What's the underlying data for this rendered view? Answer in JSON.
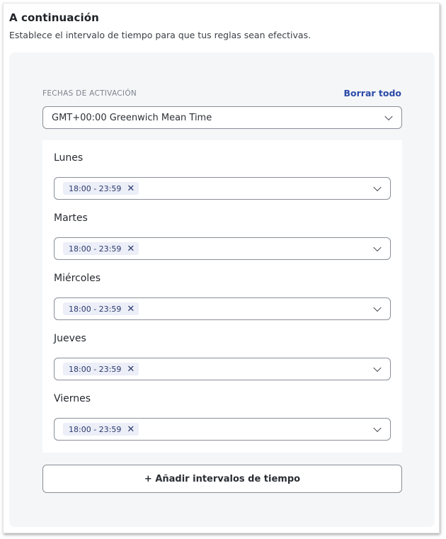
{
  "header": {
    "title": "A continuación",
    "subtitle": "Establece el intervalo de tiempo para que tus reglas sean efectivas."
  },
  "activation": {
    "label": "FECHAS DE ACTIVACIÓN",
    "clear_all": "Borrar todo",
    "timezone": "GMT+00:00 Greenwich Mean Time"
  },
  "days": [
    {
      "name": "Lunes",
      "interval": "18:00 - 23:59"
    },
    {
      "name": "Martes",
      "interval": "18:00 - 23:59"
    },
    {
      "name": "Miércoles",
      "interval": "18:00 - 23:59"
    },
    {
      "name": "Jueves",
      "interval": "18:00 - 23:59"
    },
    {
      "name": "Viernes",
      "interval": "18:00 - 23:59"
    }
  ],
  "add_button": "+ Añadir intervalos de tiempo",
  "icons": {
    "dropdown": "chevron-down-icon",
    "remove": "close-icon"
  },
  "colors": {
    "accent_link": "#2b4aa8",
    "chip_background": "#eceef8",
    "panel_background": "#f5f6f8"
  }
}
